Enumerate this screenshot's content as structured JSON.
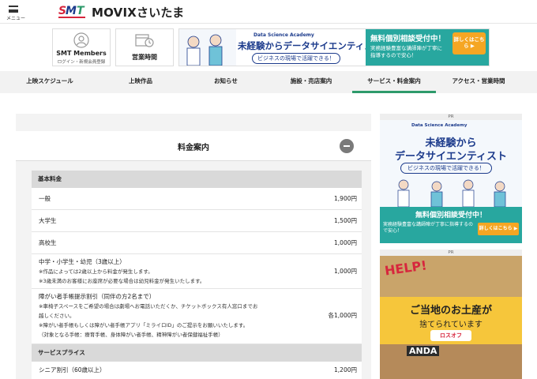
{
  "header": {
    "menu_label": "メニュー",
    "logo_text": "SMT",
    "site_title": "MOVIXさいたま"
  },
  "quick_links": {
    "members_title": "SMT Members",
    "members_sub": "ログイン・新規会員登録",
    "hours_title": "営業時間"
  },
  "top_ad": {
    "corp": "Data Science Academy",
    "headline": "未経験からデータサイエンティスト",
    "subline": "ビジネスの現場で活躍できる！",
    "free": "無料個別相談受付中！",
    "note": "実務経験豊富な講師陣が丁寧に指導するので安心！",
    "button": "詳しくはこちら ▶"
  },
  "nav": {
    "items": [
      {
        "label": "上映スケジュール",
        "active": false
      },
      {
        "label": "上映作品",
        "active": false
      },
      {
        "label": "お知らせ",
        "active": false
      },
      {
        "label": "施設・売店案内",
        "active": false
      },
      {
        "label": "サービス・料金案内",
        "active": true
      },
      {
        "label": "アクセス・営業時間",
        "active": false
      }
    ],
    "active_color": "#2e9a6b"
  },
  "fees": {
    "title": "料金案内",
    "basic_header": "基本料金",
    "rows": [
      {
        "name": "一般",
        "price": "1,900円"
      },
      {
        "name": "大学生",
        "price": "1,500円"
      },
      {
        "name": "高校生",
        "price": "1,000円"
      },
      {
        "name": "中学・小学生・幼児（3歳以上）",
        "price": "1,000円",
        "notes": [
          "※作品によっては2歳以上から料金が発生します。",
          "※3歳未満のお客様にお座席が必要な場合は幼児料金が発生いたします。"
        ]
      },
      {
        "name": "障がい者手帳提示割引（同伴の方2名まで）",
        "price": "各1,000円",
        "notes": [
          "※車椅子スペースをご希望の場合は劇場へお電話いただくか、チケットボックス有人窓口までお",
          "越しください。",
          "※障がい者手帳もしくは障がい者手帳アプリ「ミライロID」のご提示をお願いいたします。",
          "（対象となる手帳：療育手帳、身体障がい者手帳、精神障がい者保健福祉手帳）"
        ]
      }
    ],
    "service_header": "サービスプライス",
    "service_rows": [
      {
        "name": "シニア割引（60歳以上）",
        "price": "1,200円"
      }
    ]
  },
  "side_ad1": {
    "pr": "PR",
    "corp": "Data Science Academy",
    "line1": "未経験から",
    "line2": "データサイエンティスト",
    "line3": "ビジネスの現場で活躍できる！",
    "free": "無料個別相談受付中！",
    "note": "実務経験豊富な講師陣が丁寧に指導するので安心！",
    "button": "詳しくはこちら ▶"
  },
  "side_ad2": {
    "pr": "PR",
    "help": "HELP!",
    "line1": "ご当地のお土産が",
    "line2": "捨てられています",
    "brand": "ロスオフ",
    "anda": "ANDA"
  }
}
